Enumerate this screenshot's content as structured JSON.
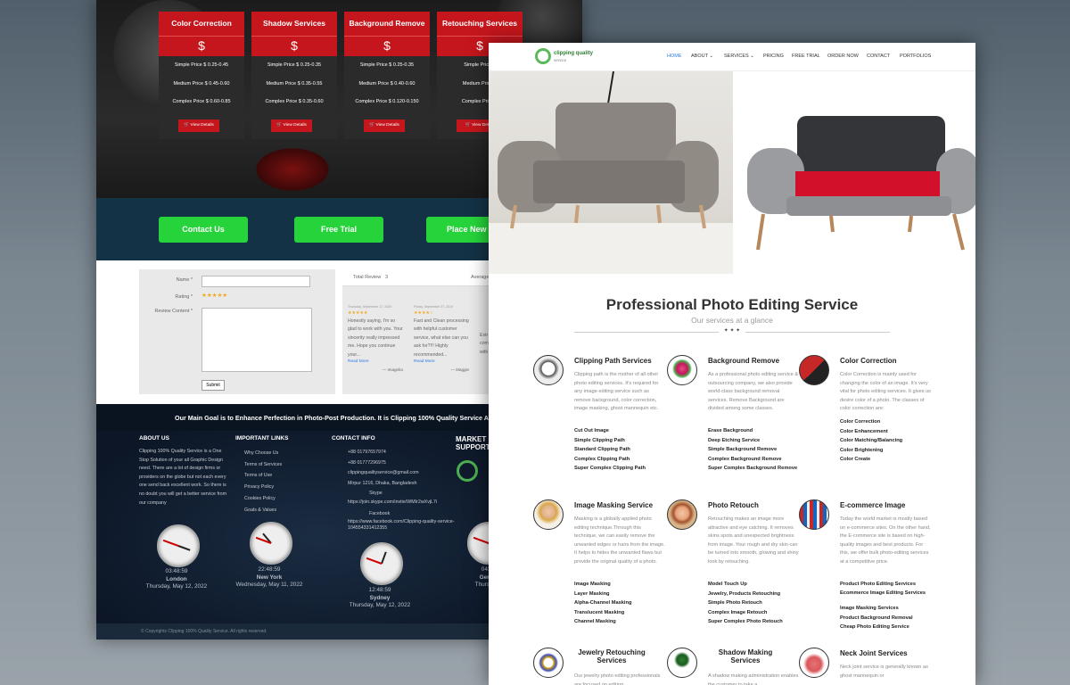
{
  "back": {
    "pricing_cards": [
      {
        "title": "Color Correction",
        "currency": "$",
        "simple": "Simple Price $ 0.25-0.45",
        "medium": "Medium Price $ 0.45-0.60",
        "complex": "Complex Price $ 0.60-0.85",
        "button": "View Details"
      },
      {
        "title": "Shadow Services",
        "currency": "$",
        "simple": "Simple Price $ 0.25-0.35",
        "medium": "Medium Price $ 0.35-0.55",
        "complex": "Complex Price $ 0.35-0.60",
        "button": "View Details"
      },
      {
        "title": "Background Remove",
        "currency": "$",
        "simple": "Simple Price $ 0.25-0.35",
        "medium": "Medium Price $ 0.40-0.60",
        "complex": "Complex Price $ 0.120-0.150",
        "button": "View Details"
      },
      {
        "title": "Retouching Services",
        "currency": "$",
        "simple": "Simple Price $",
        "medium": "Medium Price $",
        "complex": "Complex Price $",
        "button": "View Det"
      }
    ],
    "cta": {
      "contact": "Contact Us",
      "trial": "Free Trial",
      "place": "Place New O"
    },
    "review_form": {
      "name_label": "Name *",
      "rating_label": "Rating *",
      "stars": "★★★★★",
      "content_label": "Review Content *",
      "submit": "Submit"
    },
    "reviews": {
      "total_label": "Total Review",
      "total_value": "3",
      "average_label": "Average",
      "items": [
        {
          "date": "Thursday, September 17, 2020",
          "stars": "★★★★★",
          "text": "Honestly saying, I'm so glad to work with you. Your sincerity really impressed me. Hope you continue your...",
          "more": "Read More",
          "author": "— Imagebo"
        },
        {
          "date": "Friday, September 27, 2019",
          "stars": "★★★★☆",
          "text": "Fast and Clean processing with helpful customer service, what else can you ask for?!!! Highly recommended...",
          "more": "Read More",
          "author": "— Maggie"
        },
        {
          "date": "",
          "stars": "",
          "text": "Extr com with",
          "more": "",
          "author": ""
        }
      ]
    },
    "footer": {
      "tagline": "Our Main Goal is to Enhance Perfection in Photo-Post Production. It is Clipping 100% Quality Service All You N",
      "about_title": "ABOUT US",
      "about_text": "Clipping 100% Quality Service is a One Stop Solution of your all Graphic Design need. There are a lot of design firms or providers on the globe but not each every one send back excellent work. So there is no doubt you will get a better service from our company",
      "links_title": "IMPORTANT LINKS",
      "links": [
        "Why Choose Us",
        "Terms of Services",
        "Terms of Use",
        "Privacy Policy",
        "Cookies Policy",
        "Goals & Values"
      ],
      "contact_title": "CONTACT INFO",
      "contacts": [
        "+88 01797657974",
        "+88 01777296975",
        "clippingqualityservice@gmail.com",
        "Mirpur 1216, Dhaka, Bangladesh",
        "Skype",
        "https://join.skype.com/invite/WMIr2wXvjL7i",
        "Facebook",
        "https://www.facebook.com/Clipping-quality-service-104554331412355"
      ],
      "market_title": "MARKET",
      "support_title": "SUPPORT",
      "clocks": [
        {
          "time": "03:48:59",
          "city": "London",
          "date": "Thursday, May 12, 2022"
        },
        {
          "time": "22:48:59",
          "city": "New York",
          "date": "Wednesday, May 11, 2022"
        },
        {
          "time": "12:48:59",
          "city": "Sydney",
          "date": "Thursday, May 12, 2022"
        },
        {
          "time": "04:4",
          "city": "Germ",
          "date": "Thursday"
        }
      ],
      "copyright": "© Copyrights Clipping 100% Quality Service. All rights reserved."
    }
  },
  "front": {
    "logo_text": "clipping quality",
    "logo_sub": "service",
    "nav": [
      "HOME",
      "ABOUT",
      "SERVICES",
      "PRICING",
      "FREE TRIAL",
      "ORDER NOW",
      "CONTACT",
      "PORTFOLIOS"
    ],
    "heading": "Professional Photo Editing Service",
    "subheading": "Our services at a glance",
    "divider": "✦ ✦ ✦",
    "services": [
      {
        "title": "Clipping Path Services",
        "desc": "Clipping path is the mother of all other photo editing services. It's required for any image editing service such as remove background, color correction, image masking, ghost mannequin etc.",
        "items": [
          "Cut Out Image",
          "Simple Clipping Path",
          "Standard Clipping Path",
          "Complex Clipping Path",
          "Super Complex Clipping Path"
        ]
      },
      {
        "title": "Background Remove",
        "desc": "As a professional photo editing service & outsourcing company, we also provide world-class background removal services. Remove Background are divided among some classes.",
        "items": [
          "Erase Background",
          "Deep Etching Service",
          "Simple Background Remove",
          "Complex Background Remove",
          "Super Complex Background Remove"
        ]
      },
      {
        "title": "Color Correction",
        "desc": "Color Correction is mainly used for changing the color of an image. It's very vital for photo editing services. It gives us desire color of a photo. The classes of color correction are:",
        "items": [
          "Color Correction",
          "Color Enhancement",
          "Color Matching/Balancing",
          "Color Brightening",
          "Color Create"
        ]
      },
      {
        "title": "Image Masking Service",
        "desc": "Masking is a globally applied photo editing technique.Through this technique, we can easily remove the unwanted edges or hairs from the image. It helps to hides the unwanted flaws but provide the original quality of a photo.",
        "items": [
          "Image Masking",
          "Layer Masking",
          "Alpha-Channel Masking",
          "Translucent Masking",
          "Channel Masking"
        ]
      },
      {
        "title": "Photo Retouch",
        "desc": "Retouching makes an image more attractive and eye catching. It removes skins spots and unexpected brightness from image. Your rough and dry skin can be turned into smooth, glowing and shiny look by retouching.",
        "items": [
          "Model Touch Up",
          "Jewelry, Products Retouching",
          "Simple Photo Retouch",
          "Complex Image Retouch",
          "Super Complex Photo Retouch"
        ]
      },
      {
        "title": "E-commerce Image",
        "desc": "Today the world market is mostly based on e-commerce sites. On the other hand, the E-commerce site is based on high-quality images and best products. For this, we offer bulk photo-editing services at a competitive price.",
        "items": [
          "Product Photo Editing Services",
          "Ecommerce Image Editing Services",
          "Image Masking Services",
          "Product Background Removal",
          "Cheap Photo Editing Service"
        ]
      },
      {
        "title": "Jewelry Retouching Services",
        "desc": "Our jewelry photo editing professionals are focused on editing",
        "items": []
      },
      {
        "title": "Shadow Making Services",
        "desc": "A shadow making administration enables the customer to take a",
        "items": []
      },
      {
        "title": "Neck Joint Services",
        "desc": "Neck joint service is generally known as ghost mannequin or",
        "items": []
      }
    ]
  },
  "colors": {
    "red": "#c4161c",
    "green": "#26d33b",
    "navy": "#143245",
    "link": "#2c7be5"
  }
}
